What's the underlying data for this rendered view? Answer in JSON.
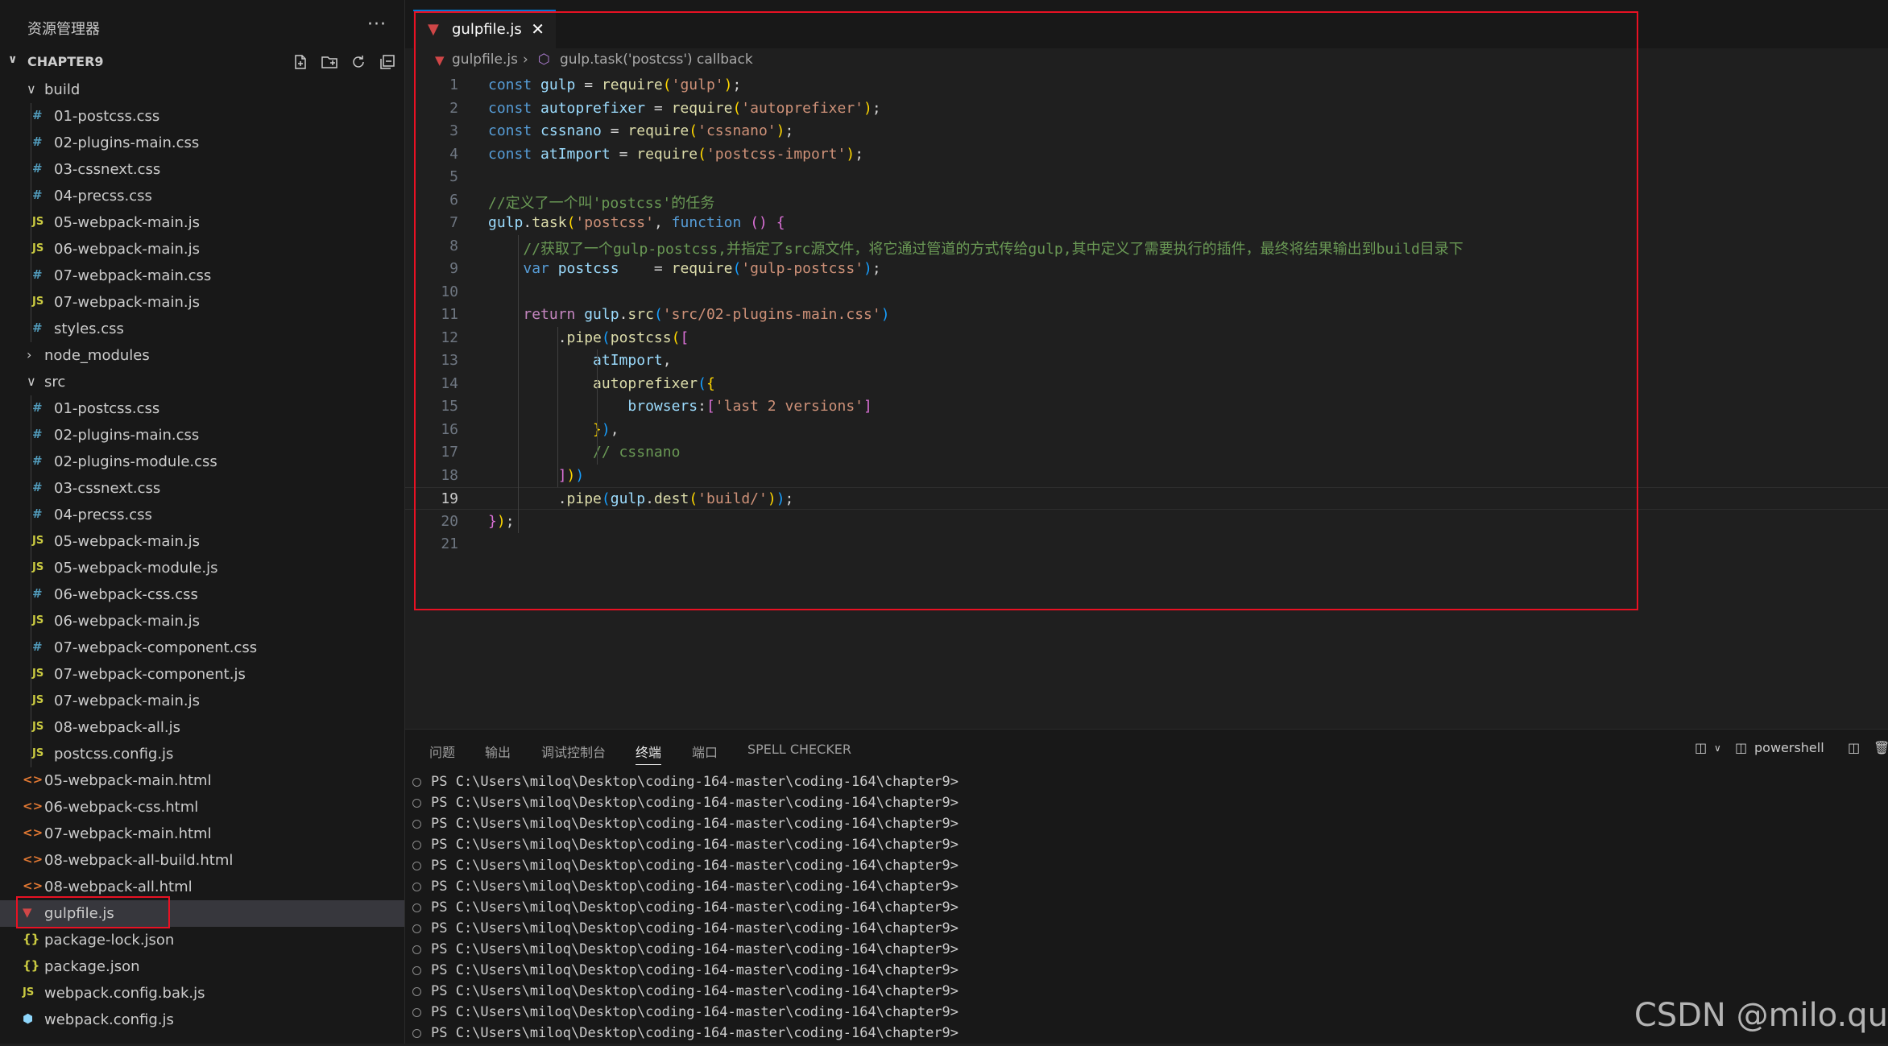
{
  "sidebar": {
    "title": "资源管理器",
    "more": "···",
    "project": "CHAPTER9",
    "tree": [
      {
        "label": "build",
        "type": "folder-open",
        "depth": 0
      },
      {
        "label": "01-postcss.css",
        "type": "css",
        "depth": 1
      },
      {
        "label": "02-plugins-main.css",
        "type": "css",
        "depth": 1
      },
      {
        "label": "03-cssnext.css",
        "type": "css",
        "depth": 1
      },
      {
        "label": "04-precss.css",
        "type": "css",
        "depth": 1
      },
      {
        "label": "05-webpack-main.js",
        "type": "js",
        "depth": 1
      },
      {
        "label": "06-webpack-main.js",
        "type": "js",
        "depth": 1
      },
      {
        "label": "07-webpack-main.css",
        "type": "css",
        "depth": 1
      },
      {
        "label": "07-webpack-main.js",
        "type": "js",
        "depth": 1
      },
      {
        "label": "styles.css",
        "type": "css",
        "depth": 1
      },
      {
        "label": "node_modules",
        "type": "folder-closed",
        "depth": 0
      },
      {
        "label": "src",
        "type": "folder-open",
        "depth": 0
      },
      {
        "label": "01-postcss.css",
        "type": "css",
        "depth": 1
      },
      {
        "label": "02-plugins-main.css",
        "type": "css",
        "depth": 1
      },
      {
        "label": "02-plugins-module.css",
        "type": "css",
        "depth": 1
      },
      {
        "label": "03-cssnext.css",
        "type": "css",
        "depth": 1
      },
      {
        "label": "04-precss.css",
        "type": "css",
        "depth": 1
      },
      {
        "label": "05-webpack-main.js",
        "type": "js",
        "depth": 1
      },
      {
        "label": "05-webpack-module.js",
        "type": "js",
        "depth": 1
      },
      {
        "label": "06-webpack-css.css",
        "type": "css",
        "depth": 1
      },
      {
        "label": "06-webpack-main.js",
        "type": "js",
        "depth": 1
      },
      {
        "label": "07-webpack-component.css",
        "type": "css",
        "depth": 1
      },
      {
        "label": "07-webpack-component.js",
        "type": "js",
        "depth": 1
      },
      {
        "label": "07-webpack-main.js",
        "type": "js",
        "depth": 1
      },
      {
        "label": "08-webpack-all.js",
        "type": "js",
        "depth": 1
      },
      {
        "label": "postcss.config.js",
        "type": "js",
        "depth": 1
      },
      {
        "label": "05-webpack-main.html",
        "type": "html",
        "depth": 0
      },
      {
        "label": "06-webpack-css.html",
        "type": "html",
        "depth": 0
      },
      {
        "label": "07-webpack-main.html",
        "type": "html",
        "depth": 0
      },
      {
        "label": "08-webpack-all-build.html",
        "type": "html",
        "depth": 0
      },
      {
        "label": "08-webpack-all.html",
        "type": "html",
        "depth": 0
      },
      {
        "label": "gulpfile.js",
        "type": "gulp",
        "depth": 0,
        "selected": true
      },
      {
        "label": "package-lock.json",
        "type": "json",
        "depth": 0
      },
      {
        "label": "package.json",
        "type": "json",
        "depth": 0
      },
      {
        "label": "webpack.config.bak.js",
        "type": "js",
        "depth": 0
      },
      {
        "label": "webpack.config.js",
        "type": "webpack",
        "depth": 0
      }
    ]
  },
  "icons": {
    "css": "#",
    "js": "JS",
    "html": "<>",
    "json": "{}",
    "webpack": "⬢",
    "gulp": "▼",
    "folder-open": "∨",
    "folder-closed": "›"
  },
  "editor": {
    "tab_label": "gulpfile.js",
    "tab_close": "✕",
    "breadcrumb_file": "gulpfile.js",
    "breadcrumb_sep": "›",
    "breadcrumb_symbol": "gulp.task('postcss') callback",
    "current_line": 19,
    "lines": [
      [
        [
          "const ",
          "k"
        ],
        [
          "gulp",
          "v"
        ],
        [
          " = ",
          "p"
        ],
        [
          "require",
          "f"
        ],
        [
          "(",
          "b1"
        ],
        [
          "'gulp'",
          "s"
        ],
        [
          "",
          "b1"
        ],
        [
          ")",
          "b1"
        ],
        [
          ";",
          "p"
        ]
      ],
      [
        [
          "const ",
          "k"
        ],
        [
          "autoprefixer",
          "v"
        ],
        [
          " = ",
          "p"
        ],
        [
          "require",
          "f"
        ],
        [
          "(",
          "b1"
        ],
        [
          "'autoprefixer'",
          "s"
        ],
        [
          ")",
          "b1"
        ],
        [
          ";",
          "p"
        ]
      ],
      [
        [
          "const ",
          "k"
        ],
        [
          "cssnano",
          "v"
        ],
        [
          " = ",
          "p"
        ],
        [
          "require",
          "f"
        ],
        [
          "(",
          "b1"
        ],
        [
          "'cssnano'",
          "s"
        ],
        [
          ")",
          "b1"
        ],
        [
          ";",
          "p"
        ]
      ],
      [
        [
          "const ",
          "k"
        ],
        [
          "atImport",
          "v"
        ],
        [
          " = ",
          "p"
        ],
        [
          "require",
          "f"
        ],
        [
          "(",
          "b1"
        ],
        [
          "'postcss-import'",
          "s"
        ],
        [
          ")",
          "b1"
        ],
        [
          ";",
          "p"
        ]
      ],
      [],
      [
        [
          "//定义了一个叫'postcss'的任务",
          "c"
        ]
      ],
      [
        [
          "gulp",
          "v"
        ],
        [
          ".",
          "p"
        ],
        [
          "task",
          "f"
        ],
        [
          "(",
          "b1"
        ],
        [
          "'postcss'",
          "s"
        ],
        [
          ", ",
          "p"
        ],
        [
          "function",
          "k"
        ],
        [
          " ",
          "p"
        ],
        [
          "()",
          "b2"
        ],
        [
          " ",
          "p"
        ],
        [
          "{",
          "b2"
        ]
      ],
      [
        [
          "    //获取了一个gulp-postcss,并指定了src源文件，将它通过管道的方式传给gulp,其中定义了需要执行的插件，最终将结果输出到build目录下",
          "c"
        ]
      ],
      [
        [
          "    ",
          "p"
        ],
        [
          "var ",
          "k"
        ],
        [
          "postcss",
          "v"
        ],
        [
          "    = ",
          "p"
        ],
        [
          "require",
          "f"
        ],
        [
          "(",
          "b3"
        ],
        [
          "'gulp-postcss'",
          "s"
        ],
        [
          ")",
          "b3"
        ],
        [
          ";",
          "p"
        ]
      ],
      [],
      [
        [
          "    ",
          "p"
        ],
        [
          "return ",
          "kw"
        ],
        [
          "gulp",
          "v"
        ],
        [
          ".",
          "p"
        ],
        [
          "src",
          "f"
        ],
        [
          "(",
          "b3"
        ],
        [
          "'src/02-plugins-main.css'",
          "s"
        ],
        [
          ")",
          "b3"
        ]
      ],
      [
        [
          "        .",
          "p"
        ],
        [
          "pipe",
          "f"
        ],
        [
          "(",
          "b3"
        ],
        [
          "postcss",
          "f"
        ],
        [
          "(",
          "b1"
        ],
        [
          "[",
          "b2"
        ]
      ],
      [
        [
          "            ",
          "p"
        ],
        [
          "atImport",
          "v"
        ],
        [
          ",",
          "p"
        ]
      ],
      [
        [
          "            ",
          "p"
        ],
        [
          "autoprefixer",
          "f"
        ],
        [
          "(",
          "b3"
        ],
        [
          "{",
          "b1"
        ]
      ],
      [
        [
          "                ",
          "p"
        ],
        [
          "browsers",
          "v"
        ],
        [
          ":",
          "p"
        ],
        [
          "[",
          "b2"
        ],
        [
          "'last 2 versions'",
          "s"
        ],
        [
          "]",
          "b2"
        ]
      ],
      [
        [
          "            ",
          "p"
        ],
        [
          "}",
          "b1"
        ],
        [
          ")",
          "b3"
        ],
        [
          ",",
          "p"
        ]
      ],
      [
        [
          "            // cssnano",
          "c"
        ]
      ],
      [
        [
          "        ",
          "p"
        ],
        [
          "]",
          "b2"
        ],
        [
          ")",
          "b1"
        ],
        [
          ")",
          "b3"
        ]
      ],
      [
        [
          "        .",
          "p"
        ],
        [
          "pipe",
          "f"
        ],
        [
          "(",
          "b3"
        ],
        [
          "gulp",
          "v"
        ],
        [
          ".",
          "p"
        ],
        [
          "dest",
          "f"
        ],
        [
          "(",
          "b1"
        ],
        [
          "'build/'",
          "s"
        ],
        [
          ")",
          "b1"
        ],
        [
          ")",
          "b3"
        ],
        [
          ";",
          "p"
        ]
      ],
      [
        [
          "}",
          "b2"
        ],
        [
          ")",
          "b1"
        ],
        [
          ";",
          "p"
        ]
      ],
      []
    ]
  },
  "panel": {
    "tabs": [
      "问题",
      "输出",
      "调试控制台",
      "终端",
      "端口",
      "SPELL CHECKER"
    ],
    "active_tab": "终端",
    "shell": "powershell",
    "terminal_lines": [
      "PS C:\\Users\\miloq\\Desktop\\coding-164-master\\coding-164\\chapter9>",
      "PS C:\\Users\\miloq\\Desktop\\coding-164-master\\coding-164\\chapter9>",
      "PS C:\\Users\\miloq\\Desktop\\coding-164-master\\coding-164\\chapter9>",
      "PS C:\\Users\\miloq\\Desktop\\coding-164-master\\coding-164\\chapter9>",
      "PS C:\\Users\\miloq\\Desktop\\coding-164-master\\coding-164\\chapter9>",
      "PS C:\\Users\\miloq\\Desktop\\coding-164-master\\coding-164\\chapter9>",
      "PS C:\\Users\\miloq\\Desktop\\coding-164-master\\coding-164\\chapter9>",
      "PS C:\\Users\\miloq\\Desktop\\coding-164-master\\coding-164\\chapter9>",
      "PS C:\\Users\\miloq\\Desktop\\coding-164-master\\coding-164\\chapter9>",
      "PS C:\\Users\\miloq\\Desktop\\coding-164-master\\coding-164\\chapter9>",
      "PS C:\\Users\\miloq\\Desktop\\coding-164-master\\coding-164\\chapter9>",
      "PS C:\\Users\\miloq\\Desktop\\coding-164-master\\coding-164\\chapter9>",
      "PS C:\\Users\\miloq\\Desktop\\coding-164-master\\coding-164\\chapter9>"
    ]
  },
  "watermark": "CSDN @milo.qu",
  "colors": {
    "accent": "#0078d4",
    "highlight_box": "#e81123",
    "background": "#1f1f1f",
    "sidebar": "#181818"
  }
}
